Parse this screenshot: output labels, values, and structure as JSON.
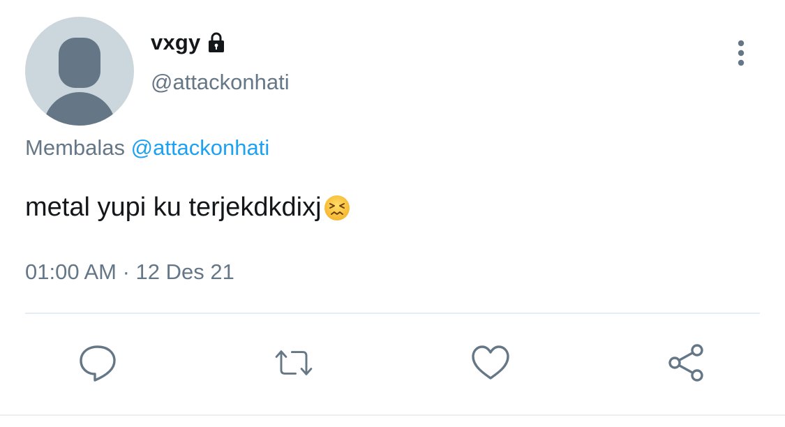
{
  "tweet": {
    "display_name": "vxgy",
    "handle": "@attackonhati",
    "reply_prefix": "Membalas",
    "reply_mention": "@attackonhati",
    "text": "metal yupi ku terjekdkdixj",
    "emoji": "persevering-face-emoji",
    "timestamp": "01:00 AM · 12 Des 21",
    "locked": true
  },
  "icons": {
    "lock": "lock-icon",
    "more": "more-vertical-icon",
    "reply": "reply-icon",
    "retweet": "retweet-icon",
    "like": "heart-icon",
    "share": "share-icon"
  },
  "colors": {
    "text_primary": "#14171a",
    "text_secondary": "#657786",
    "link": "#1da1f2",
    "avatar_bg": "#ccd6dd",
    "avatar_figure": "#657786",
    "divider": "#e6ecf0"
  }
}
